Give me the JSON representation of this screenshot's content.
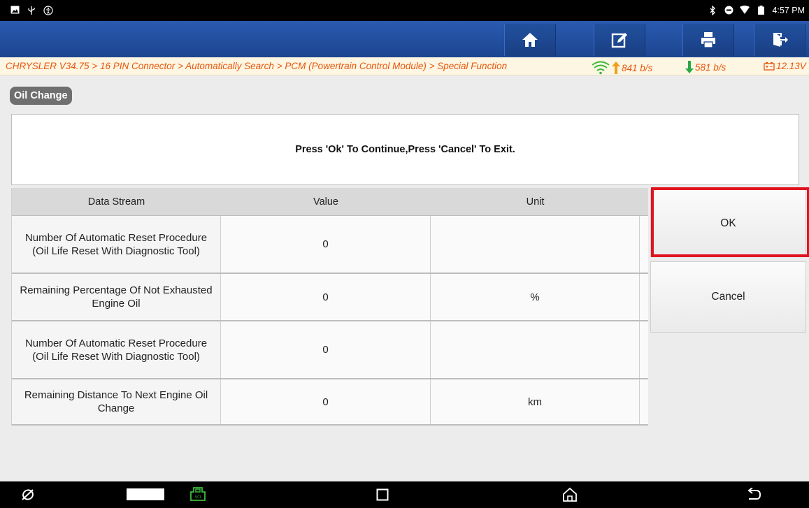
{
  "statusbar": {
    "left_icons": [
      "image-icon",
      "usb-icon",
      "accessibility-icon"
    ],
    "time": "4:57 PM"
  },
  "toolbar": {
    "buttons": [
      "home-icon",
      "edit-note-icon",
      "print-icon",
      "exit-icon"
    ]
  },
  "breadcrumb": {
    "path": "CHRYSLER V34.75 > 16 PIN Connector > Automatically Search > PCM (Powertrain Control Module) > Special Function",
    "upload_rate": "841 b/s",
    "download_rate": "581 b/s",
    "battery_voltage": "12.13V"
  },
  "page": {
    "title": "Oil Change",
    "message": "Press 'Ok' To Continue,Press 'Cancel' To Exit."
  },
  "table": {
    "headers": [
      "Data Stream",
      "Value",
      "Unit"
    ],
    "rows": [
      {
        "name": "Number Of Automatic Reset Procedure (Oil Life Reset With Diagnostic Tool)",
        "value": "0",
        "unit": ""
      },
      {
        "name": "Remaining Percentage Of Not Exhausted Engine Oil",
        "value": "0",
        "unit": "%"
      },
      {
        "name": "Number Of Automatic Reset Procedure (Oil Life Reset With Diagnostic Tool)",
        "value": "0",
        "unit": ""
      },
      {
        "name": "Remaining Distance To Next Engine Oil Change",
        "value": "0",
        "unit": "km"
      }
    ]
  },
  "actions": {
    "ok_label": "OK",
    "cancel_label": "Cancel"
  },
  "navbar": {
    "icons": [
      "browser-icon",
      "taskbar-thumbnail",
      "vci-icon",
      "recents-icon",
      "home-icon",
      "back-icon"
    ]
  },
  "colors": {
    "toolbar_blue": "#1c4590",
    "breadcrumb_orange": "#e8570e",
    "highlight_red": "#e0141f",
    "green": "#3cba3c"
  }
}
